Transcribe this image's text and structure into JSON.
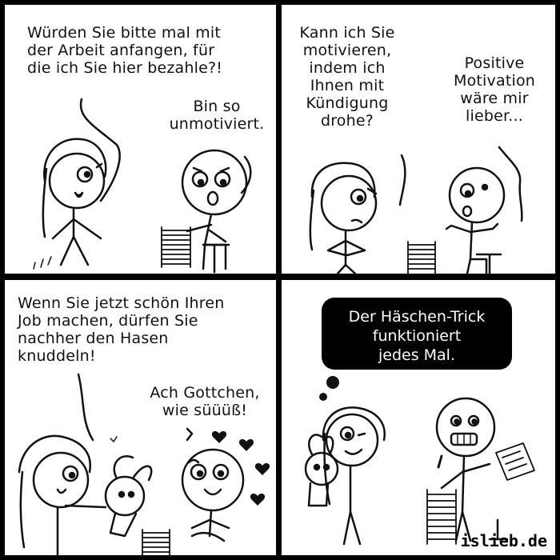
{
  "panels": [
    {
      "woman_text": "Würden Sie bitte mal mit\nder Arbeit anfangen, für\ndie ich Sie hier bezahle?!",
      "man_text": "Bin so\nunmotiviert."
    },
    {
      "woman_text": "Kann ich Sie\nmotivieren,\nindem ich\nIhnen mit\nKündigung\ndrohe?",
      "man_text": "Positive\nMotivation\nwäre mir\nlieber..."
    },
    {
      "woman_text": "Wenn Sie jetzt schön Ihren\nJob machen, dürfen Sie\nnachher den Hasen\nknuddeln!",
      "man_text": "Ach Gottchen,\nwie süüüß!"
    },
    {
      "thought_text": "Der Häschen-Trick\nfunktioniert\njedes Mal."
    }
  ],
  "signature": "islieb.de",
  "colors": {
    "ink": "#111111",
    "background": "#ffffff",
    "gutter": "#000000"
  }
}
